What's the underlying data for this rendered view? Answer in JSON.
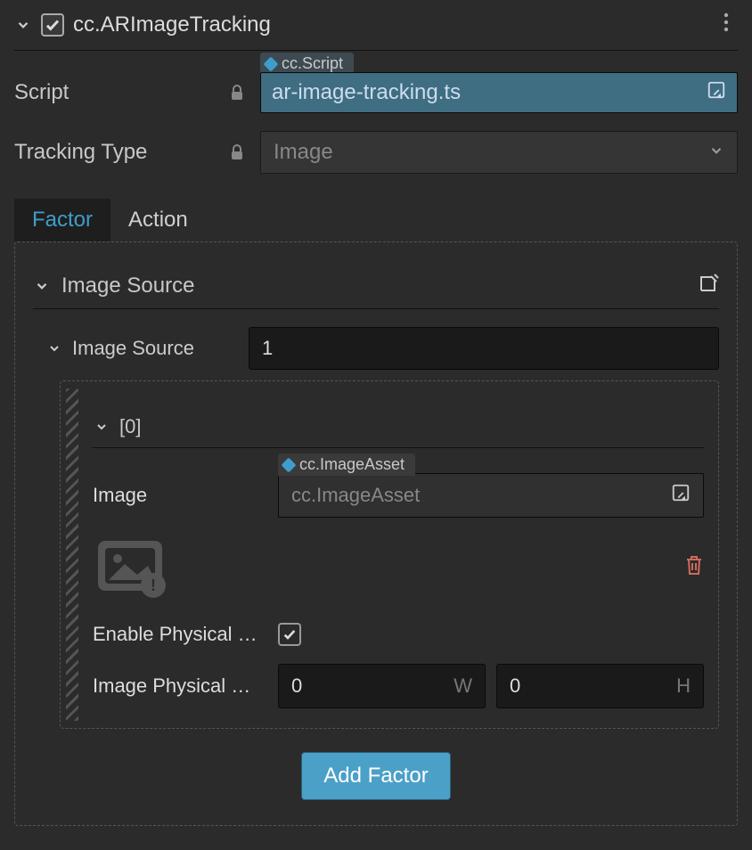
{
  "header": {
    "title": "cc.ARImageTracking",
    "checked": true
  },
  "script": {
    "label": "Script",
    "badge": "cc.Script",
    "value": "ar-image-tracking.ts"
  },
  "tracking_type": {
    "label": "Tracking Type",
    "value": "Image"
  },
  "tabs": {
    "factor": "Factor",
    "action": "Action"
  },
  "image_source": {
    "section_label": "Image Source",
    "list_label": "Image Source",
    "count": "1",
    "item0": {
      "index_label": "[0]",
      "image_label": "Image",
      "image_badge": "cc.ImageAsset",
      "image_placeholder": "cc.ImageAsset",
      "enable_physical_label": "Enable Physical …",
      "enable_physical_checked": true,
      "physical_size_label": "Image Physical …",
      "w_value": "0",
      "w_suffix": "W",
      "h_value": "0",
      "h_suffix": "H"
    }
  },
  "add_factor_label": "Add Factor"
}
